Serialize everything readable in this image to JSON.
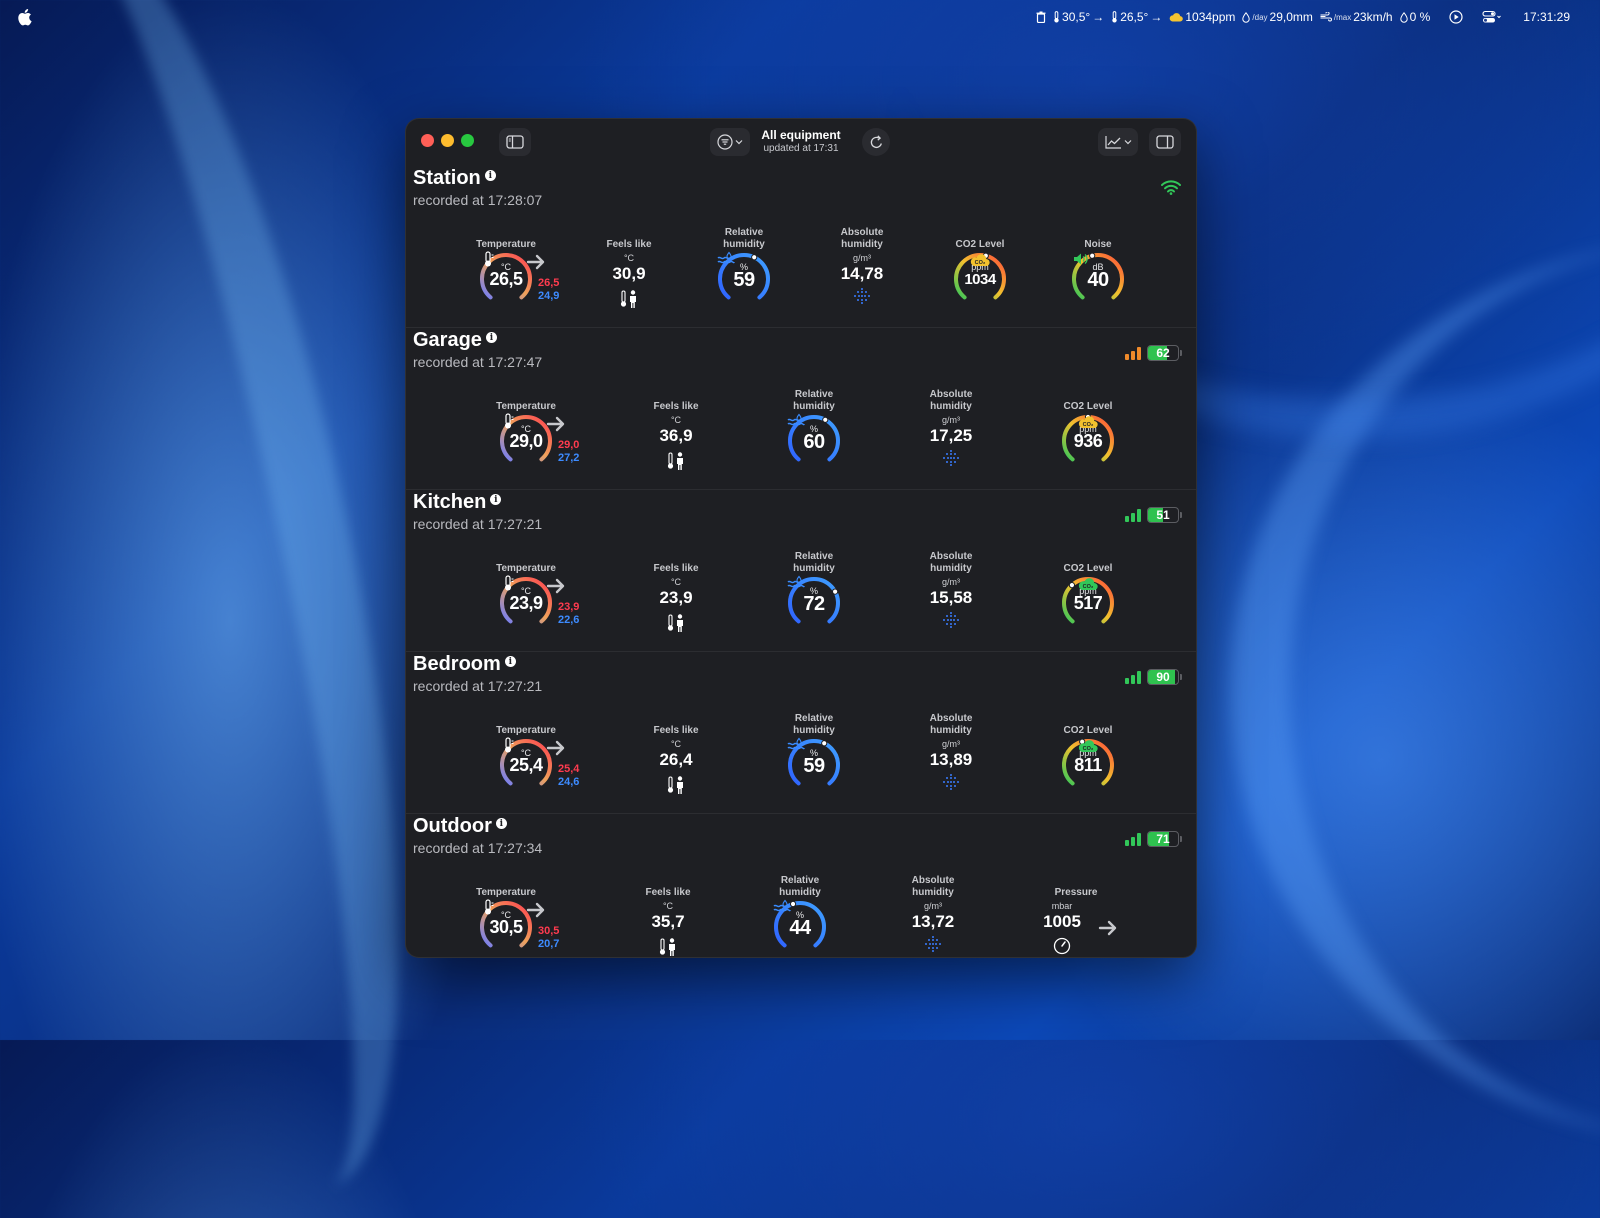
{
  "menubar": {
    "temp_in": "30,5°",
    "temp_out": "26,5°",
    "co2": "1034ppm",
    "rain_label": "/day",
    "rain": "29,0mm",
    "wind_label": "/max",
    "wind": "23km/h",
    "rain_prob": "0 %",
    "clock": "17:31:29"
  },
  "window": {
    "title": "All equipment",
    "subtitle": "updated at 17:31"
  },
  "labels": {
    "temperature": "Temperature",
    "feels_like": "Feels like",
    "relative_humidity": "Relative humidity",
    "absolute_humidity": "Absolute humidity",
    "co2": "CO2 Level",
    "noise": "Noise",
    "pressure": "Pressure",
    "unit_c": "°C",
    "unit_pct": "%",
    "unit_gm3": "g/m³",
    "unit_ppm": "ppm",
    "unit_db": "dB",
    "unit_mbar": "mbar",
    "co2_badge": "CO₂"
  },
  "modules": [
    {
      "name": "Station",
      "recorded": "recorded at 17:28:07",
      "temp": "26,5",
      "temp_max": "26,5",
      "temp_min": "24,9",
      "feels": "30,9",
      "rh": "59",
      "rh_level": 0.59,
      "ah": "14,78",
      "co2": "1034",
      "co2_level": 0.55,
      "co2_status": "#f2c12e",
      "noise": "40",
      "noise_level": 0.45,
      "connection": "wifi"
    },
    {
      "name": "Garage",
      "recorded": "recorded at 17:27:47",
      "temp": "29,0",
      "temp_max": "29,0",
      "temp_min": "27,2",
      "feels": "36,9",
      "rh": "60",
      "rh_level": 0.6,
      "ah": "17,25",
      "co2": "936",
      "co2_level": 0.5,
      "co2_status": "#f2c12e",
      "signal": 3,
      "signal_color": "#f08a2a",
      "battery": "62",
      "battery_level": 0.62
    },
    {
      "name": "Kitchen",
      "recorded": "recorded at 17:27:21",
      "temp": "23,9",
      "temp_max": "23,9",
      "temp_min": "22,6",
      "feels": "23,9",
      "rh": "72",
      "rh_level": 0.72,
      "ah": "15,58",
      "co2": "517",
      "co2_level": 0.35,
      "co2_status": "#32c759",
      "signal": 3,
      "signal_color": "#32c759",
      "battery": "51",
      "battery_level": 0.51
    },
    {
      "name": "Bedroom",
      "recorded": "recorded at 17:27:21",
      "temp": "25,4",
      "temp_max": "25,4",
      "temp_min": "24,6",
      "feels": "26,4",
      "rh": "59",
      "rh_level": 0.59,
      "ah": "13,89",
      "co2": "811",
      "co2_level": 0.45,
      "co2_status": "#32c759",
      "signal": 3,
      "signal_color": "#32c759",
      "battery": "90",
      "battery_level": 0.9
    },
    {
      "name": "Outdoor",
      "recorded": "recorded at 17:27:34",
      "temp": "30,5",
      "temp_max": "30,5",
      "temp_min": "20,7",
      "feels": "35,7",
      "rh": "44",
      "rh_level": 0.44,
      "ah": "13,72",
      "pressure": "1005",
      "signal": 3,
      "signal_color": "#32c759",
      "battery": "71",
      "battery_level": 0.71
    }
  ]
}
